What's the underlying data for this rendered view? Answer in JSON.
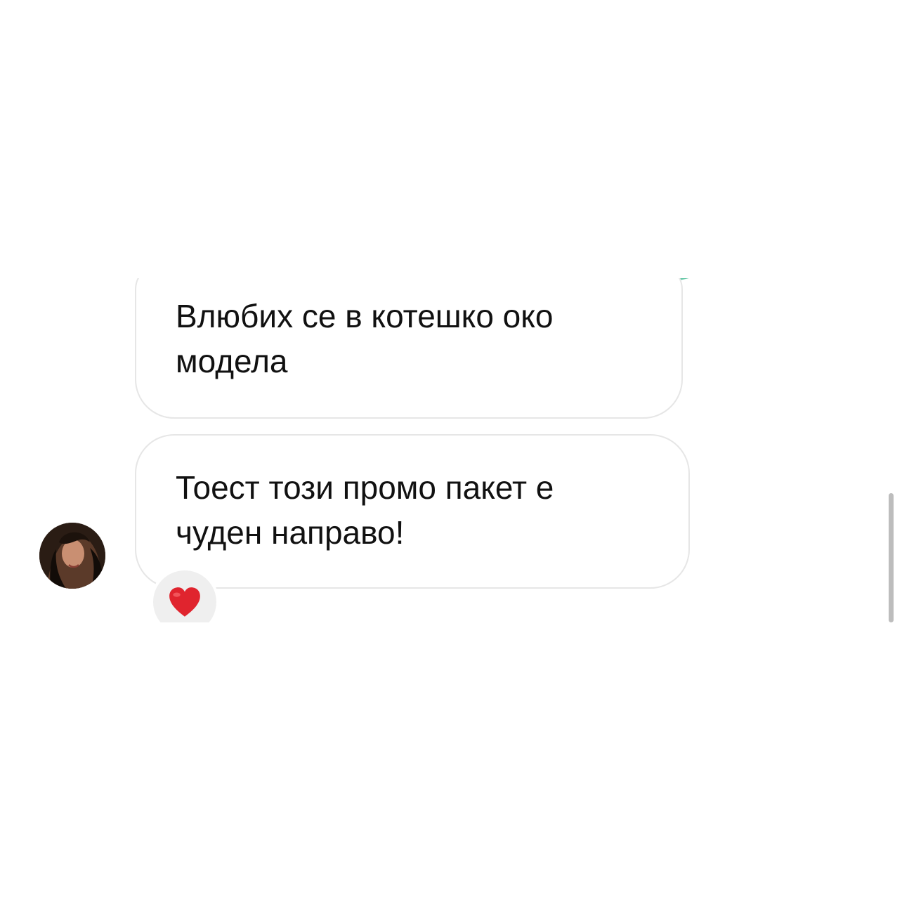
{
  "conversation": {
    "messages": [
      {
        "text": "Влюбих се в котешко око модела"
      },
      {
        "text": "Тоест този промо пакет е чуден направо!",
        "reaction": "❤️"
      }
    ]
  },
  "icons": {
    "avatar": "profile-photo-icon",
    "reaction": "heart-icon",
    "sticker": "sticker-peek-icon"
  },
  "colors": {
    "background": "#ffffff",
    "bubble_border": "#e6e6e6",
    "text": "#111111",
    "reaction_bg": "#efefef",
    "heart": "#e0242e",
    "scrollbar": "#bdbdbd",
    "sticker": "#62c7a5"
  }
}
